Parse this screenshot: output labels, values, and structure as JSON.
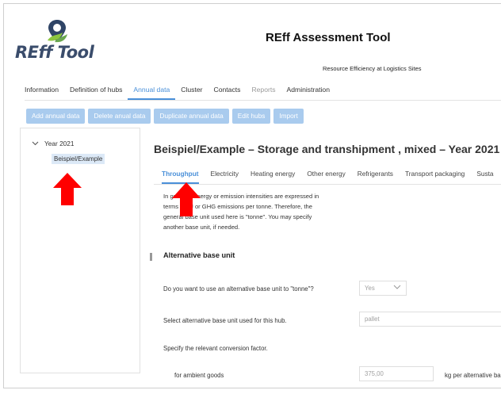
{
  "app": {
    "logo_text": "REff Tool",
    "title": "REff Assessment Tool",
    "subtitle": "Resource Efficiency at Logistics Sites"
  },
  "nav": {
    "items": [
      {
        "label": "Information"
      },
      {
        "label": "Definition of hubs"
      },
      {
        "label": "Annual data",
        "active": true
      },
      {
        "label": "Cluster"
      },
      {
        "label": "Contacts"
      },
      {
        "label": "Reports",
        "muted": true
      },
      {
        "label": "Administration"
      }
    ]
  },
  "toolbar": {
    "add_label": "Add annual data",
    "delete_label": "Delete anual data",
    "duplicate_label": "Duplicate annual data",
    "edit_hubs_label": "Edit hubs",
    "import_label": "Import"
  },
  "tree": {
    "year_label": "Year 2021",
    "hub_label": "Beispiel/Example"
  },
  "main": {
    "title": "Beispiel/Example – Storage and transhipment , mixed – Year 2021",
    "tabs": [
      {
        "label": "Throughput",
        "active": true
      },
      {
        "label": "Electricity"
      },
      {
        "label": "Heating energy"
      },
      {
        "label": "Other energy"
      },
      {
        "label": "Refrigerants"
      },
      {
        "label": "Transport packaging"
      },
      {
        "label": "Susta"
      }
    ],
    "intro_lines": [
      "In general, energy or emission intensities are expressed in",
      "terms of TJ or GHG emissions per tonne. Therefore, the",
      "general base unit used here is \"tonne\". You may specify",
      "another base unit, if needed."
    ],
    "section_title": "Alternative base unit",
    "q1_label": "Do you want to use an alternative base unit to \"tonne\"?",
    "q1_value": "Yes",
    "q2_label": "Select alternative base unit used for this hub.",
    "q2_value": "pallet",
    "q3_label": "Specify the relevant conversion factor.",
    "ambient_label": "for ambient goods",
    "ambient_value": "375,00",
    "ambient_unit": "kg per alternative ba"
  },
  "colors": {
    "accent": "#4a90d9",
    "button_bg": "#a9cbee",
    "selected_bg": "#dce9f7",
    "arrow": "#ff0000"
  }
}
